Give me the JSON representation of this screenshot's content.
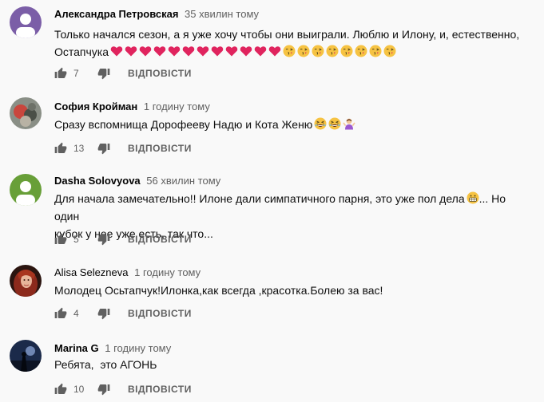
{
  "comments": [
    {
      "author": "Александра Петровская",
      "time": "35 хвилин тому",
      "text_line1": "Только начался сезон, а я уже хочу чтобы они выиграли. Люблю и Илону, и, естественно,",
      "text_line2": "Остапчука",
      "likes": "7",
      "reply": "ВІДПОВІСТИ",
      "avatar_color": "#7b5ea7",
      "avatar_initial": ""
    },
    {
      "author": "София Кройман",
      "time": "1 годину тому",
      "text_line1": "Сразу вспомнища Дорофееву Надю и Кота Женю",
      "likes": "13",
      "reply": "ВІДПОВІСТИ"
    },
    {
      "author": "Dasha Solovyova",
      "time": "56 хвилин тому",
      "text_line1": "Для начала замечательно!! Илоне дали симпатичного парня, это уже пол дела",
      "text_line1_end": "... Но один",
      "text_line2": "кубок у нее уже есть, так что...",
      "likes": "5",
      "reply": "ВІДПОВІСТИ",
      "avatar_color": "#689f38"
    },
    {
      "author": "Alisa Selezneva",
      "time": "1 годину тому",
      "text_line1": "Молодец Осьтапчук!Илонка,как всегда ,красотка.Болею за вас!",
      "likes": "4",
      "reply": "ВІДПОВІСТИ"
    },
    {
      "author": "Marina G",
      "time": "1 годину тому",
      "text_line1": "Ребята,  это АГОНЬ",
      "likes": "10",
      "reply": "ВІДПОВІСТИ"
    }
  ],
  "icons": {
    "like": "thumb-up-icon",
    "dislike": "thumb-down-icon",
    "heart": "red-heart-emoji",
    "kiss": "face-blowing-kiss-emoji",
    "laugh": "grinning-squinting-emoji",
    "shrug": "person-gesturing-emoji",
    "grimace": "grimacing-face-emoji"
  },
  "colors": {
    "text": "#0f0f0f",
    "secondary": "#606060",
    "background": "#f9f9f9",
    "heart": "#e0245e"
  }
}
